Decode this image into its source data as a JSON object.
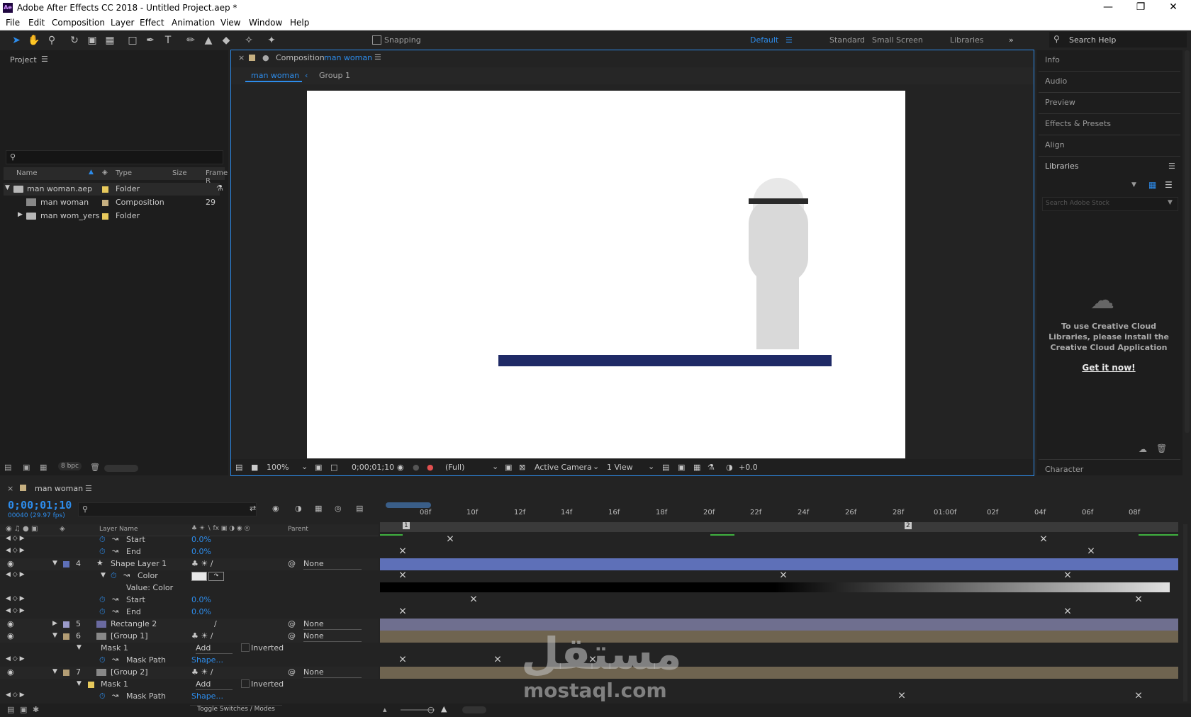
{
  "app": {
    "title": "Adobe After Effects CC 2018 - Untitled Project.aep *",
    "icon_label": "Ae"
  },
  "window_controls": [
    "minimize-icon",
    "restore-icon",
    "close-icon"
  ],
  "menu": [
    "File",
    "Edit",
    "Composition",
    "Layer",
    "Effect",
    "Animation",
    "View",
    "Window",
    "Help"
  ],
  "toolbar": {
    "snapping_label": "Snapping",
    "workspaces": [
      "Default",
      "Standard",
      "Small Screen",
      "Libraries"
    ],
    "search_placeholder": "Search Help"
  },
  "project": {
    "title": "Project",
    "search_placeholder": "",
    "columns": [
      "Name",
      "Type",
      "Size",
      "Frame R"
    ],
    "items": [
      {
        "name": "man woman.aep",
        "type": "Folder",
        "size": ""
      },
      {
        "name": "man woman",
        "type": "Composition",
        "size": "29"
      },
      {
        "name": "man wom_yers",
        "type": "Folder",
        "size": ""
      }
    ],
    "bpc": "8 bpc"
  },
  "composition": {
    "tab_prefix": "Composition",
    "tab_name": "man woman",
    "breadcrumb": [
      "man woman",
      "Group 1"
    ],
    "zoom": "100%",
    "timecode": "0;00;01;10",
    "resolution": "(Full)",
    "camera": "Active Camera",
    "views": "1 View",
    "exposure": "+0.0"
  },
  "right_panels": {
    "items": [
      "Info",
      "Audio",
      "Preview",
      "Effects & Presets",
      "Align"
    ],
    "libraries_title": "Libraries",
    "stock_placeholder": "Search Adobe Stock",
    "cc_message": "To use Creative Cloud Libraries, please install the Creative Cloud Application",
    "cc_link": "Get it now!",
    "character": "Character"
  },
  "timeline": {
    "comp_name": "man woman",
    "timecode": "0;00;01;10",
    "frame_info": "00040 (29.97 fps)",
    "col_layer_name": "Layer Name",
    "col_parent": "Parent",
    "ruler": [
      "08f",
      "10f",
      "12f",
      "14f",
      "16f",
      "18f",
      "20f",
      "22f",
      "24f",
      "26f",
      "28f",
      "01:00f",
      "02f",
      "04f",
      "06f",
      "08f"
    ],
    "rows": [
      {
        "indent": 2,
        "name": "Start",
        "value": "0.0%"
      },
      {
        "indent": 2,
        "name": "End",
        "value": "0.0%"
      },
      {
        "num": "4",
        "name": "Shape Layer 1",
        "parent": "None",
        "color": "#5e70b8"
      },
      {
        "indent": 2,
        "name": "Color"
      },
      {
        "indent": 3,
        "name": "Value: Color"
      },
      {
        "indent": 2,
        "name": "Start",
        "value": "0.0%"
      },
      {
        "indent": 2,
        "name": "End",
        "value": "0.0%"
      },
      {
        "num": "5",
        "name": "Rectangle 2",
        "parent": "None",
        "color": "#9a9ac9"
      },
      {
        "num": "6",
        "name": "[Group 1]",
        "parent": "None",
        "color": "#b39d74"
      },
      {
        "indent": 1,
        "name": "Mask 1",
        "mode": "Add",
        "inverted": "Inverted"
      },
      {
        "indent": 2,
        "name": "Mask Path",
        "value": "Shape..."
      },
      {
        "num": "7",
        "name": "[Group 2]",
        "parent": "None",
        "color": "#b39d74"
      },
      {
        "indent": 1,
        "name": "Mask 1",
        "mode": "Add",
        "inverted": "Inverted"
      },
      {
        "indent": 2,
        "name": "Mask Path",
        "value": "Shape..."
      }
    ],
    "toggle_label": "Toggle Switches / Modes"
  },
  "watermark": {
    "arabic": "مستقل",
    "latin": "mostaql.com"
  },
  "colors": {
    "accent": "#2d8ceb",
    "floor": "#1f2a66",
    "shape_bar": "#5e70b8",
    "group_bar": "#6f6450"
  }
}
